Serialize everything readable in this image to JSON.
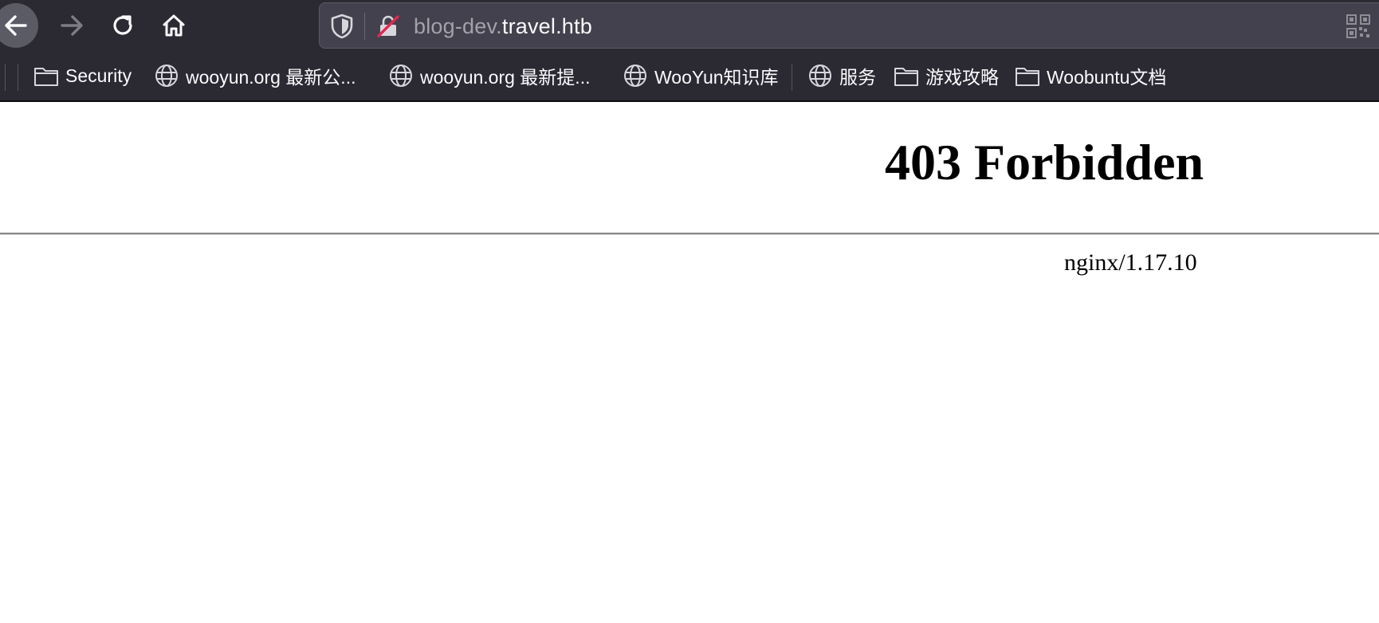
{
  "browser": {
    "url": {
      "subdomain": "blog-dev.",
      "host": "travel.htb"
    },
    "bookmarks": [
      {
        "label": "Security",
        "icon": "folder-icon"
      },
      {
        "label": "wooyun.org 最新公...",
        "icon": "globe-icon"
      },
      {
        "label": "wooyun.org 最新提...",
        "icon": "globe-icon"
      },
      {
        "label": "WooYun知识库",
        "icon": "globe-icon"
      },
      {
        "label": "服务",
        "icon": "globe-icon"
      },
      {
        "label": "游戏攻略",
        "icon": "folder-icon"
      },
      {
        "label": "Woobuntu文档",
        "icon": "folder-icon"
      }
    ]
  },
  "page": {
    "title": "403 Forbidden",
    "server": "nginx/1.17.10"
  },
  "colors": {
    "toolbar": "#2b2a33",
    "urlbar": "#42414d",
    "insecure_lock": "#e22850"
  }
}
